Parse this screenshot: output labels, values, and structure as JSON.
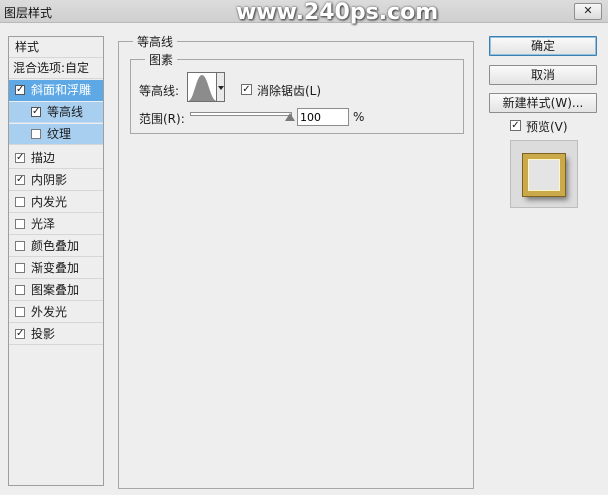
{
  "window": {
    "title": "图层样式",
    "watermark": "www.240ps.com",
    "close_label": "✕"
  },
  "styles_list": {
    "header": "样式",
    "blend_options": "混合选项:自定",
    "items": [
      {
        "label": "斜面和浮雕",
        "checked": true,
        "state": "selected"
      },
      {
        "label": "等高线",
        "checked": true,
        "state": "selected-child"
      },
      {
        "label": "纹理",
        "checked": false,
        "state": "child"
      },
      {
        "label": "描边",
        "checked": true
      },
      {
        "label": "内阴影",
        "checked": true
      },
      {
        "label": "内发光",
        "checked": false
      },
      {
        "label": "光泽",
        "checked": false
      },
      {
        "label": "颜色叠加",
        "checked": false
      },
      {
        "label": "渐变叠加",
        "checked": false
      },
      {
        "label": "图案叠加",
        "checked": false
      },
      {
        "label": "外发光",
        "checked": false
      },
      {
        "label": "投影",
        "checked": true
      }
    ]
  },
  "panel": {
    "group_title": "等高线",
    "sub_group_title": "图素",
    "contour_label": "等高线:",
    "antialias_label": "消除锯齿(L)",
    "antialias_checked": true,
    "range_label": "范围(R):",
    "range_value": "100",
    "range_unit": "%",
    "range_level_percent": 100
  },
  "buttons": {
    "ok": "确定",
    "cancel": "取消",
    "new_style": "新建样式(W)...",
    "preview_label": "预览(V)",
    "preview_checked": true
  },
  "colors": {
    "selection": "#5ea8e6",
    "selection_light": "#a9cff0",
    "frame_gold": "#c9a94a"
  }
}
